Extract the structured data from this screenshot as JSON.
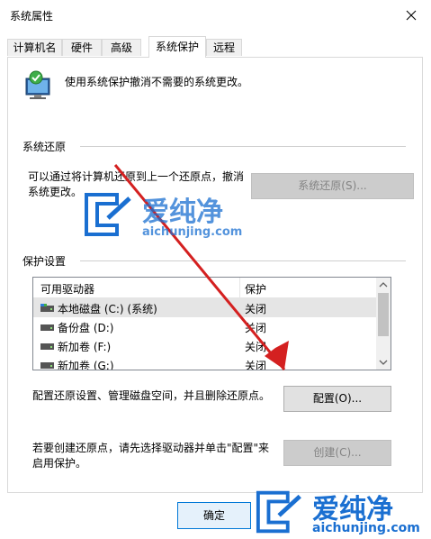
{
  "window": {
    "title": "系统属性"
  },
  "tabs": [
    {
      "label": "计算机名"
    },
    {
      "label": "硬件"
    },
    {
      "label": "高级"
    },
    {
      "label": "系统保护"
    },
    {
      "label": "远程"
    }
  ],
  "header": {
    "text": "使用系统保护撤消不需要的系统更改。"
  },
  "restore": {
    "group_label": "系统还原",
    "desc_line1": "可以通过将计算机还原到上一个还原点，撤消",
    "desc_line2": "系统更改。",
    "button_label": "系统还原(S)..."
  },
  "protection": {
    "group_label": "保护设置",
    "columns": [
      "可用驱动器",
      "保护"
    ],
    "drives": [
      {
        "name": "本地磁盘 (C:) (系统)",
        "protection": "关闭"
      },
      {
        "name": "备份盘 (D:)",
        "protection": "关闭"
      },
      {
        "name": "新加卷 (F:)",
        "protection": "关闭"
      },
      {
        "name": "新加卷 (G:)",
        "protection": "关闭"
      }
    ],
    "configure_desc": "配置还原设置、管理磁盘空间，并且删除还原点。",
    "configure_label": "配置(O)...",
    "create_desc_line1": "若要创建还原点，请先选择驱动器并单击\"配置\"来",
    "create_desc_line2": "启用保护。",
    "create_label": "创建(C)..."
  },
  "footer": {
    "ok_label": "确定"
  },
  "watermark": {
    "brand": "爱纯净",
    "domain": "aichunjing.com",
    "color": "#1a6fd1"
  },
  "annotation": {
    "arrow_color": "#d42020"
  }
}
